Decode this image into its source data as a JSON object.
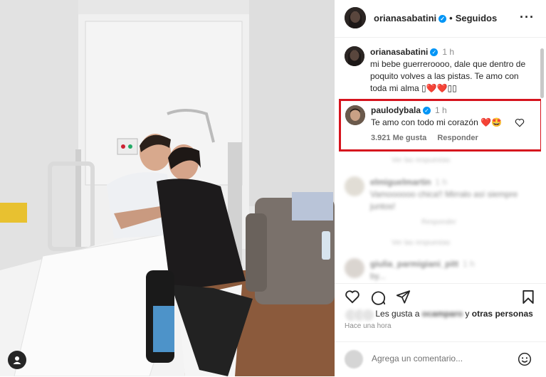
{
  "post": {
    "author": "orianasabatini",
    "follow_status": "Seguidos",
    "separator": "•"
  },
  "caption": {
    "user": "orianasabatini",
    "time": "1 h",
    "text": "mi bebe guerreroooo, dale que dentro de poquito volves a las pistas. Te amo con toda mi alma ▯❤️❤️▯▯"
  },
  "highlighted_comment": {
    "user": "paulodybala",
    "time": "1 h",
    "text": "Te amo con todo mi corazón ❤️🤩",
    "likes": "3.921 Me gusta",
    "reply": "Responder"
  },
  "blurred_comments": [
    {
      "user": "elmiguelmartin",
      "time": "1 h",
      "text": "Vamoooooo chica!! Mirralo así siempre juntos!"
    },
    {
      "user": "giulia_parmigiani_pitt",
      "time": "1 h",
      "text": "by..."
    }
  ],
  "faded_lines": {
    "view_replies_1": "Ver las respuestas",
    "view_replies_2": "Ver las respuestas",
    "reply_small": "Responder"
  },
  "likes": {
    "prefix": "Les gusta a",
    "user": "ocamparo",
    "suffix": " y ",
    "others": "otras personas"
  },
  "posted_ago": "Hace una hora",
  "add_comment": {
    "placeholder": "Agrega un comentario..."
  },
  "colors": {
    "highlight_border": "#d6141e",
    "verified": "#0095f6",
    "like_red": "#ed4956"
  },
  "icons": {
    "more": "more-horizontal-icon",
    "heart": "heart-icon",
    "comment": "comment-icon",
    "share": "share-icon",
    "save": "bookmark-icon",
    "emoji": "emoji-icon",
    "user_tag": "user-tag-icon"
  }
}
